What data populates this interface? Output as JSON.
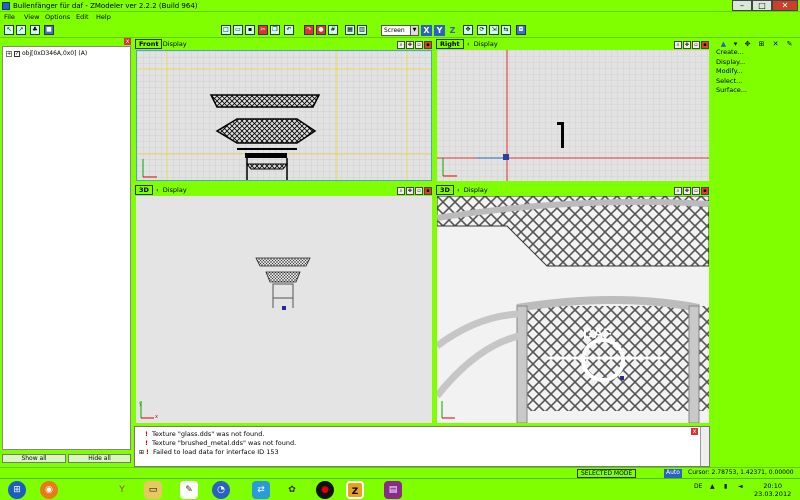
{
  "window": {
    "title": "Bullenfänger für daf - ZModeler ver 2.2.2 (Build 964)",
    "min_label": "–",
    "max_label": "□",
    "close_label": "✕"
  },
  "menu": [
    "File",
    "View",
    "Options",
    "Edit",
    "Help"
  ],
  "toolbar": {
    "screen_select": "Screen",
    "axis_x": "X",
    "axis_y": "Y",
    "axis_z": "Z"
  },
  "scene_tree": {
    "item_label": "obj[0xD346A,0x0] (A)",
    "show_all": "Show all",
    "hide_all": "Hide all"
  },
  "viewports": {
    "front": {
      "tab": "Front",
      "display": "Display"
    },
    "right": {
      "tab": "Right",
      "display": "Display"
    },
    "p3d_left": {
      "tab": "3D",
      "display": "Display"
    },
    "p3d_right": {
      "tab": "3D",
      "display": "Display"
    },
    "axis_x": "x",
    "axis_y": "y",
    "axis_z": "z"
  },
  "right_panel": {
    "items": [
      "Create...",
      "Display...",
      "Modify...",
      "Select...",
      "Surface..."
    ]
  },
  "console": {
    "lines": [
      "Texture \"glass.dds\" was not found.",
      "Texture \"brushed_metal.dds\" was not found.",
      "Failed to load data for interface ID 153"
    ]
  },
  "status": {
    "mode": "SELECTED MODE",
    "auto": "Auto",
    "cursor": "Cursor: 2.78753, 1.42371, 0.00000"
  },
  "taskbar": {
    "lang": "DE",
    "time": "20:10",
    "date": "23.03.2012"
  },
  "colors": {
    "chrome_green": "#7fff00",
    "viewport_bg": "#e2e2e2",
    "grid_yellow": "#e8d860",
    "accent_blue": "#2a62c4"
  }
}
